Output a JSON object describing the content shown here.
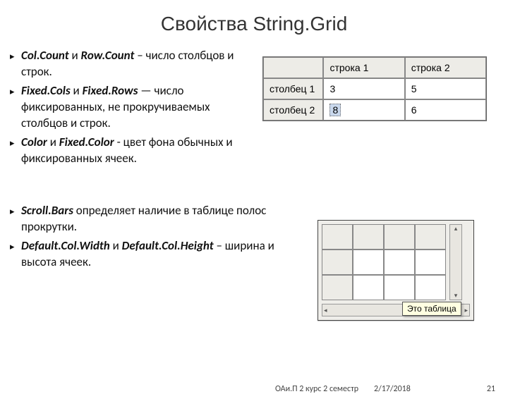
{
  "title": "Свойства String.Grid",
  "bullets_top": [
    {
      "term1": "Col.Count",
      "joiner": "и",
      "term2": "Row.Count",
      "tail": " – число столбцов и строк."
    },
    {
      "term1": "Fixed.Cols",
      "joiner": "и",
      "term2": "Fixed.Rows",
      "tail": " — число фиксированных, не прокручиваемых столбцов и строк."
    },
    {
      "term1": "Color",
      "joiner": "и",
      "term2": "Fixed.Color",
      "tail": " - цвет фона обычных и фиксированных ячеек."
    }
  ],
  "bullets_bottom": [
    {
      "term1": "Scroll.Bars",
      "tail": " определяет наличие в таблице полос прокрутки."
    },
    {
      "term1": "Default.Col.Width",
      "joiner": "и",
      "term2": "Default.Col.Height",
      "tail": " – ширина и высота ячеек."
    }
  ],
  "grid": {
    "header": [
      "",
      "строка 1",
      "строка 2"
    ],
    "rows": [
      {
        "label": "столбец 1",
        "c1": "3",
        "c2": "5"
      },
      {
        "label": "столбец 2",
        "c1": "8",
        "c2": "6",
        "c1_selected": true
      }
    ]
  },
  "tooltip": "Это таблица",
  "footer": {
    "course": "ОАи.П 2 курс 2 семестр",
    "date": "2/17/2018",
    "page": "21"
  }
}
